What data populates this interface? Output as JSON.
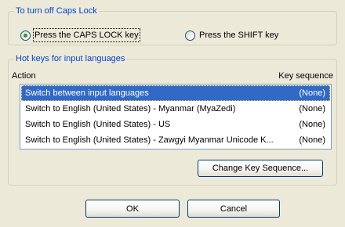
{
  "caps_lock_group": {
    "title": "To turn off Caps Lock",
    "options": [
      {
        "label": "Press the CAPS LOCK key",
        "checked": true
      },
      {
        "label": "Press the SHIFT key",
        "checked": false
      }
    ]
  },
  "hotkeys_group": {
    "title": "Hot keys for input languages",
    "columns": {
      "action": "Action",
      "key_sequence": "Key sequence"
    },
    "rows": [
      {
        "action": "Switch between input languages",
        "key": "(None)",
        "selected": true
      },
      {
        "action": "Switch to English (United States) - Myanmar (MyaZedi)",
        "key": "(None)",
        "selected": false
      },
      {
        "action": "Switch to English (United States) - US",
        "key": "(None)",
        "selected": false
      },
      {
        "action": "Switch to English (United States) - Zawgyi Myanmar Unicode K...",
        "key": "(None)",
        "selected": false
      }
    ],
    "change_button": "Change Key Sequence..."
  },
  "buttons": {
    "ok": "OK",
    "cancel": "Cancel"
  },
  "colors": {
    "group_title": "#0046d5",
    "selection": "#316ac5",
    "radio_dot": "#21a121"
  }
}
